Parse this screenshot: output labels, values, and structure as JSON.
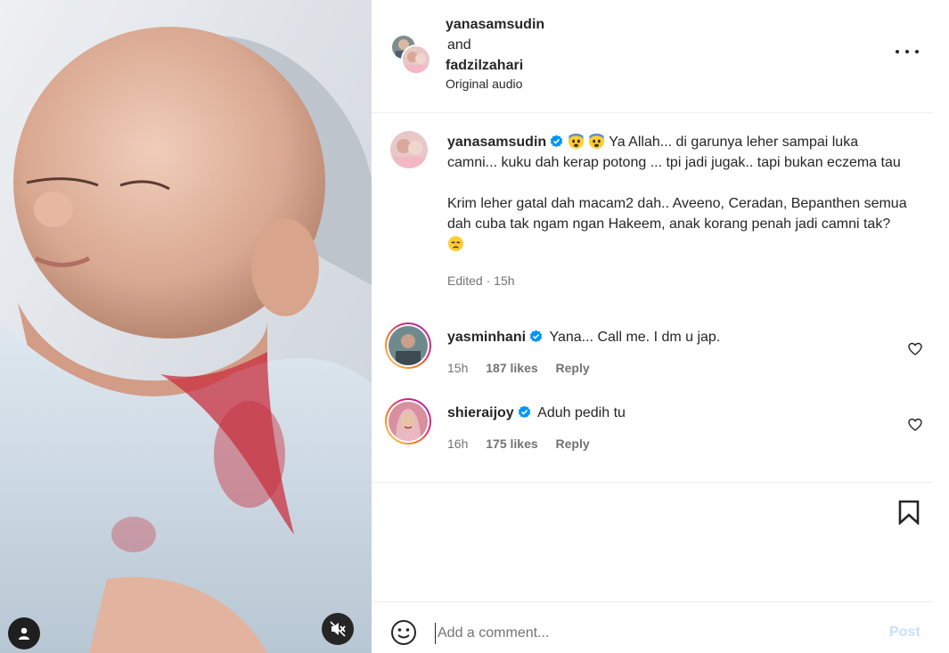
{
  "header": {
    "user1": "yanasamsudin",
    "and_label": "and",
    "user2": "fadzilzahari",
    "audio": "Original audio",
    "more_icon": "more-horizontal-icon"
  },
  "caption": {
    "username": "yanasamsudin",
    "verified": true,
    "line1": "Ya Allah... di garunya leher sampai luka camni... kuku dah kerap potong ... tpi jadi jugak.. tapi bukan eczema tau",
    "line2": "Krim leher gatal dah macam2 dah.. Aveeno, Ceradan, Bepanthen semua dah cuba tak ngam ngan Hakeem, anak korang penah jadi camni tak?",
    "edited": "Edited",
    "time": "15h"
  },
  "comments": [
    {
      "username": "yasminhani",
      "verified": true,
      "text": "Yana... Call me. I dm u jap.",
      "time": "15h",
      "likes": "187 likes",
      "reply": "Reply"
    },
    {
      "username": "shieraijoy",
      "verified": true,
      "text": "Aduh pedih tu",
      "time": "16h",
      "likes": "175 likes",
      "reply": "Reply"
    }
  ],
  "composer": {
    "placeholder": "Add a comment...",
    "post_label": "Post"
  },
  "colors": {
    "accent_blue": "#0095f6",
    "post_disabled": "#c7e0fd",
    "verified": "#0095f6",
    "muted_text": "#737373"
  }
}
